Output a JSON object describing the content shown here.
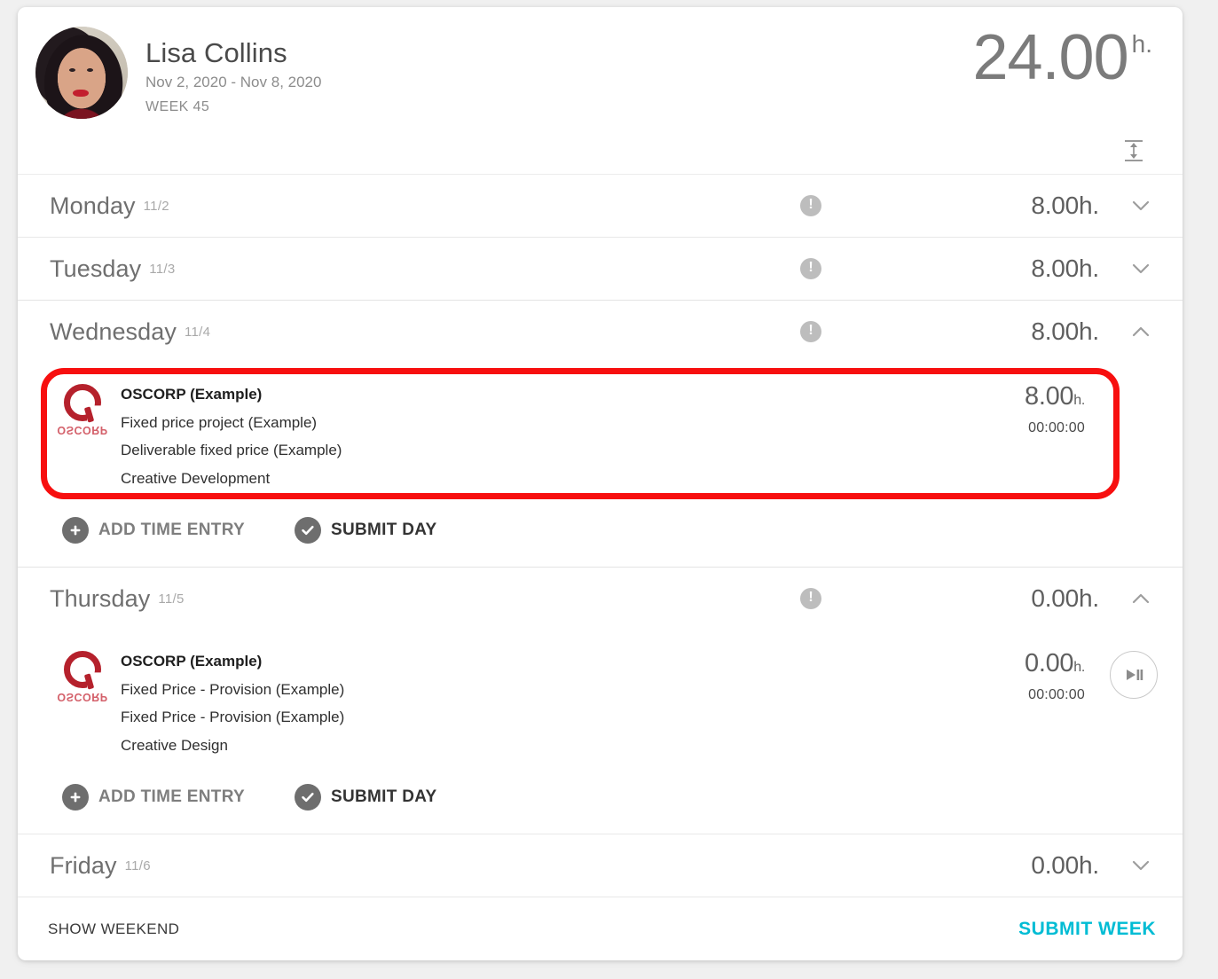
{
  "header": {
    "user_name": "Lisa Collins",
    "date_range": "Nov 2, 2020 - Nov 8, 2020",
    "week_label": "WEEK 45",
    "total_value": "24.00",
    "total_unit": "h.",
    "fit_icon": "fit-height-icon"
  },
  "days": [
    {
      "name": "Monday",
      "date": "11/2",
      "hours": "8.00h.",
      "warning": true,
      "expanded": false,
      "chevron": "chevron-down-icon",
      "entries": []
    },
    {
      "name": "Tuesday",
      "date": "11/3",
      "hours": "8.00h.",
      "warning": true,
      "expanded": false,
      "chevron": "chevron-down-icon",
      "entries": []
    },
    {
      "name": "Wednesday",
      "date": "11/4",
      "hours": "8.00h.",
      "warning": true,
      "expanded": true,
      "highlighted": true,
      "chevron": "chevron-up-icon",
      "entries": [
        {
          "logo_alt": "OSCORP",
          "client": "OSCORP (Example)",
          "project": "Fixed price project (Example)",
          "deliverable": "Deliverable fixed price (Example)",
          "task": "Creative Development",
          "hours": "8.00",
          "hours_unit": "h.",
          "timer": "00:00:00",
          "has_timer_button": false
        }
      ],
      "actions": {
        "add_entry": "ADD TIME ENTRY",
        "submit_day": "SUBMIT DAY"
      }
    },
    {
      "name": "Thursday",
      "date": "11/5",
      "hours": "0.00h.",
      "warning": true,
      "expanded": true,
      "highlighted": false,
      "chevron": "chevron-up-icon",
      "entries": [
        {
          "logo_alt": "OSCORP",
          "client": "OSCORP (Example)",
          "project": "Fixed Price - Provision (Example)",
          "deliverable": "Fixed Price - Provision (Example)",
          "task": "Creative Design",
          "hours": "0.00",
          "hours_unit": "h.",
          "timer": "00:00:00",
          "has_timer_button": true,
          "timer_button_icon": "play-pause-icon"
        }
      ],
      "actions": {
        "add_entry": "ADD TIME ENTRY",
        "submit_day": "SUBMIT DAY"
      }
    },
    {
      "name": "Friday",
      "date": "11/6",
      "hours": "0.00h.",
      "warning": false,
      "expanded": false,
      "chevron": "chevron-down-icon",
      "entries": []
    }
  ],
  "footer": {
    "show_weekend": "SHOW WEEKEND",
    "submit_week": "SUBMIT WEEK"
  },
  "colors": {
    "accent": "#00bcd4",
    "highlight": "#f70f0f",
    "logo": "#b5212c",
    "page_bg": "#f0f0f0",
    "card_bg": "#ffffff"
  }
}
